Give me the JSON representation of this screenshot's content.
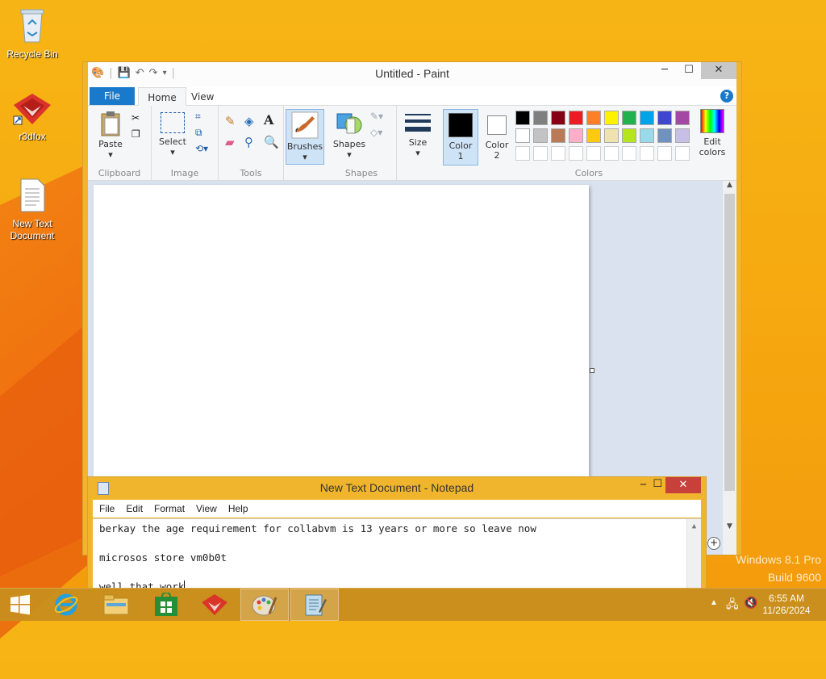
{
  "desktop": {
    "icons": [
      {
        "label": "Recycle Bin",
        "icon": "recycle-bin-icon"
      },
      {
        "label": "r3dfox",
        "icon": "r3dfox-icon"
      },
      {
        "label": "New Text Document",
        "icon": "text-document-icon"
      }
    ],
    "watermark": {
      "line1": "Windows 8.1 Pro",
      "line2": "Build 9600"
    }
  },
  "paint": {
    "title": "Untitled - Paint",
    "tabs": {
      "file": "File",
      "home": "Home",
      "view": "View"
    },
    "groups": {
      "clipboard": {
        "label": "Clipboard",
        "paste": "Paste"
      },
      "image": {
        "label": "Image",
        "select": "Select"
      },
      "tools": {
        "label": "Tools"
      },
      "brushes": {
        "label": "Brushes"
      },
      "shapes": {
        "label": "Shapes",
        "button": "Shapes"
      },
      "size": {
        "label": "Size"
      },
      "colors": {
        "label": "Colors",
        "color1": "Color\n1",
        "color2": "Color\n2",
        "edit": "Edit colors"
      }
    },
    "palette_row1": [
      "#000000",
      "#7f7f7f",
      "#880015",
      "#ed1c24",
      "#ff7f27",
      "#fff200",
      "#22b14c",
      "#00a2e8",
      "#3f48cc",
      "#a349a4"
    ],
    "palette_row2": [
      "#ffffff",
      "#c3c3c3",
      "#b97a57",
      "#ffaec9",
      "#ffc90e",
      "#efe4b0",
      "#b5e61d",
      "#99d9ea",
      "#7092be",
      "#c8bfe7"
    ],
    "color1": "#000000",
    "color2": "#ffffff"
  },
  "notepad": {
    "title": "New Text Document - Notepad",
    "menu": [
      "File",
      "Edit",
      "Format",
      "View",
      "Help"
    ],
    "lines": [
      "berkay the age requirement for collabvm is 13 years or more so leave now",
      "",
      "microsos store vm0b0t",
      "",
      "well that work"
    ]
  },
  "taskbar": {
    "time": "6:55 AM",
    "date": "11/26/2024"
  }
}
